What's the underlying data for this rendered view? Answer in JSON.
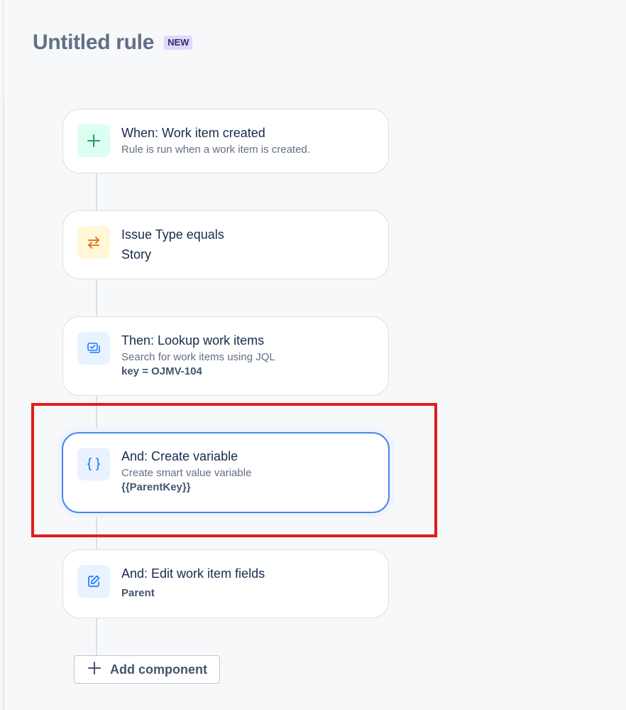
{
  "header": {
    "title": "Untitled rule",
    "badge": "NEW"
  },
  "components": [
    {
      "kind": "trigger",
      "icon": "plus-icon",
      "title": "When: Work item created",
      "description": "Rule is run when a work item is created."
    },
    {
      "kind": "condition",
      "icon": "swap-arrows-icon",
      "title": "Issue Type equals",
      "value": "Story"
    },
    {
      "kind": "action",
      "icon": "lookup-icon",
      "title": "Then: Lookup work items",
      "description": "Search for work items using JQL",
      "value": "key = OJMV-104"
    },
    {
      "kind": "action",
      "icon": "braces-icon",
      "title": "And: Create variable",
      "description": "Create smart value variable",
      "value": "{{ParentKey}}",
      "selected": true
    },
    {
      "kind": "action",
      "icon": "edit-icon",
      "title": "And: Edit work item fields",
      "value": "Parent"
    }
  ],
  "add_component": {
    "label": "Add component"
  },
  "colors": {
    "highlight": "#e11d1d",
    "selected_border": "#4688ec",
    "trigger_icon": "#22a06b",
    "condition_icon": "#e56910",
    "action_icon": "#1d7afc"
  }
}
